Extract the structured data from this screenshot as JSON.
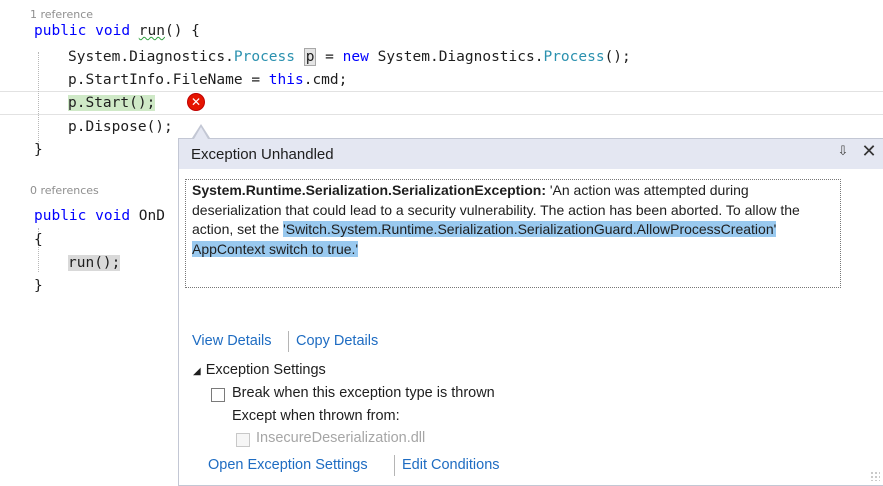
{
  "code": {
    "codelens_1": "1 reference",
    "codelens_2": "0 references",
    "l1_kw_public": "public",
    "l1_kw_void": "void",
    "l1_method": "run",
    "l1_rest": "() {",
    "l2_pre": "System.Diagnostics.",
    "l2_type": "Process",
    "l2_var": "p",
    "l2_eq": " = ",
    "l2_kw_new": "new",
    "l2_mid": " System.Diagnostics.",
    "l2_type2": "Process",
    "l2_end": "();",
    "l3_pre": "p.StartInfo.FileName = ",
    "l3_kw_this": "this",
    "l3_end": ".cmd;",
    "l4_code": "p.Start();",
    "l5_code": "p.Dispose();",
    "l6_brace": "}",
    "l8_kw_public": "public",
    "l8_kw_void": "void",
    "l8_method": "OnD",
    "l9_brace": "{",
    "l10_code": "run();",
    "l11_brace": "}"
  },
  "popup": {
    "title": "Exception Unhandled",
    "pin_glyph": "⇩",
    "close_glyph": "✕",
    "error_glyph": "✕",
    "exception_type": "System.Runtime.Serialization.SerializationException:",
    "message_plain": " 'An action was attempted during deserialization that could lead to a security vulnerability. The action has been aborted. To allow the action, set the ",
    "message_selected": "'Switch.System.Runtime.Serialization.SerializationGuard.AllowProcessCreation' AppContext switch to true.'",
    "view_details": "View Details",
    "copy_details": "Copy Details",
    "settings_header": "Exception Settings",
    "break_option": "Break when this exception type is thrown",
    "except_label": "Except when thrown from:",
    "dll_option": "InsecureDeserialization.dll",
    "open_settings": "Open Exception Settings",
    "edit_conditions": "Edit Conditions"
  },
  "state": {
    "break_checked": false,
    "dll_checked": false,
    "dll_enabled": false
  },
  "colors": {
    "keyword": "#0000ff",
    "type": "#2b91af",
    "link": "#1e6cc2",
    "selection": "#99c9ef",
    "error": "#e51400",
    "popup_header": "#e4e7f2"
  }
}
